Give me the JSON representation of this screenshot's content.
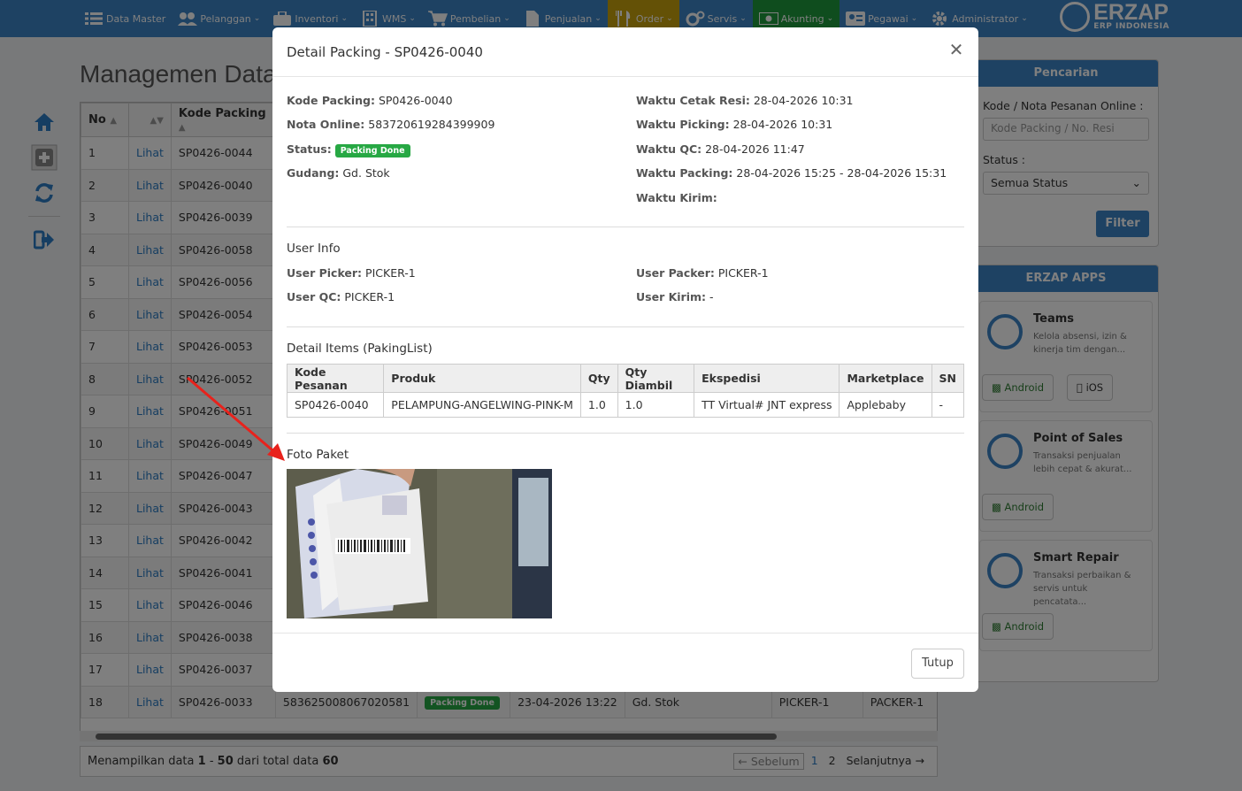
{
  "nav": {
    "items": [
      {
        "label": "Data Master",
        "icon": "list-icon"
      },
      {
        "label": "Pelanggan",
        "icon": "users-icon"
      },
      {
        "label": "Inventori",
        "icon": "briefcase-icon"
      },
      {
        "label": "WMS",
        "icon": "building-icon"
      },
      {
        "label": "Pembelian",
        "icon": "cart-icon"
      },
      {
        "label": "Penjualan",
        "icon": "document-icon"
      },
      {
        "label": "Order",
        "icon": "utensils-icon"
      },
      {
        "label": "Servis",
        "icon": "gears-icon"
      },
      {
        "label": "Akunting",
        "icon": "money-icon"
      },
      {
        "label": "Pegawai",
        "icon": "id-card-icon"
      },
      {
        "label": "Administrator",
        "icon": "gear-icon"
      }
    ],
    "brand": {
      "name": "ERZAP",
      "sub": "ERP INDONESIA"
    },
    "colors": {
      "bar": "#3c84c6",
      "order": "#c9a20d",
      "akunting": "#1f9a3c"
    }
  },
  "page": {
    "title": "Managemen Data"
  },
  "table": {
    "headers": [
      "No",
      "",
      "Kode Packing"
    ],
    "rows": [
      {
        "no": "1",
        "link": "Lihat",
        "kode": "SP0426-0044"
      },
      {
        "no": "2",
        "link": "Lihat",
        "kode": "SP0426-0040"
      },
      {
        "no": "3",
        "link": "Lihat",
        "kode": "SP0426-0039"
      },
      {
        "no": "4",
        "link": "Lihat",
        "kode": "SP0426-0058"
      },
      {
        "no": "5",
        "link": "Lihat",
        "kode": "SP0426-0056"
      },
      {
        "no": "6",
        "link": "Lihat",
        "kode": "SP0426-0054"
      },
      {
        "no": "7",
        "link": "Lihat",
        "kode": "SP0426-0053"
      },
      {
        "no": "8",
        "link": "Lihat",
        "kode": "SP0426-0052"
      },
      {
        "no": "9",
        "link": "Lihat",
        "kode": "SP0426-0051"
      },
      {
        "no": "10",
        "link": "Lihat",
        "kode": "SP0426-0049"
      },
      {
        "no": "11",
        "link": "Lihat",
        "kode": "SP0426-0047"
      },
      {
        "no": "12",
        "link": "Lihat",
        "kode": "SP0426-0043"
      },
      {
        "no": "13",
        "link": "Lihat",
        "kode": "SP0426-0042"
      },
      {
        "no": "14",
        "link": "Lihat",
        "kode": "SP0426-0041"
      },
      {
        "no": "15",
        "link": "Lihat",
        "kode": "SP0426-0046"
      },
      {
        "no": "16",
        "link": "Lihat",
        "kode": "SP0426-0038"
      },
      {
        "no": "17",
        "link": "Lihat",
        "kode": "SP0426-0037"
      },
      {
        "no": "18",
        "link": "Lihat",
        "kode": "SP0426-0033"
      }
    ],
    "row18_extra": {
      "nota": "583625008067020581",
      "status": "Packing Done",
      "waktu": "23-04-2026 13:22",
      "gudang": "Gd. Stok",
      "picker": "PICKER-1",
      "packer": "PACKER-1"
    }
  },
  "footer": {
    "info_prefix": "Menampilkan data",
    "range_start": "1",
    "range_sep": "-",
    "range_end": "50",
    "info_mid": "dari total data",
    "total": "60",
    "prev": "← Sebelum",
    "page1": "1",
    "page2": "2",
    "next": "Selanjutnya →"
  },
  "search": {
    "title": "Pencarian",
    "label1": "Kode / Nota Pesanan Online :",
    "placeholder": "Kode Packing / No. Resi",
    "label2": "Status :",
    "status_value": "Semua Status",
    "filter": "Filter"
  },
  "apps": {
    "title": "ERZAP APPS",
    "list": [
      {
        "name": "Teams",
        "desc": "Kelola absensi, izin & kinerja tim dengan...",
        "btn1": "Android",
        "btn2": "iOS"
      },
      {
        "name": "Point of Sales",
        "desc": "Transaksi penjualan lebih cepat & akurat...",
        "btn1": "Android"
      },
      {
        "name": "Smart Repair",
        "desc": "Transaksi perbaikan & servis untuk pencatata...",
        "btn1": "Android"
      }
    ]
  },
  "modal": {
    "title": "Detail Packing - SP0426-0040",
    "left": [
      {
        "k": "Kode Packing:",
        "v": "SP0426-0040"
      },
      {
        "k": "Nota Online:",
        "v": "583720619284399909"
      },
      {
        "k": "Status:",
        "badge": "Packing Done"
      },
      {
        "k": "Gudang:",
        "v": "Gd. Stok"
      }
    ],
    "right": [
      {
        "k": "Waktu Cetak Resi:",
        "v": "28-04-2026 10:31"
      },
      {
        "k": "Waktu Picking:",
        "v": "28-04-2026 10:31"
      },
      {
        "k": "Waktu QC:",
        "v": "28-04-2026 11:47"
      },
      {
        "k": "Waktu Packing:",
        "v": "28-04-2026 15:25 - 28-04-2026 15:31"
      },
      {
        "k": "Waktu Kirim:",
        "v": ""
      }
    ],
    "user_info_title": "User Info",
    "users_left": [
      {
        "k": "User Picker:",
        "v": "PICKER-1"
      },
      {
        "k": "User QC:",
        "v": "PICKER-1"
      }
    ],
    "users_right": [
      {
        "k": "User Packer:",
        "v": "PICKER-1"
      },
      {
        "k": "User Kirim:",
        "v": "-"
      }
    ],
    "items_title": "Detail Items (PakingList)",
    "items_headers": [
      "Kode Pesanan",
      "Produk",
      "Qty",
      "Qty Diambil",
      "Ekspedisi",
      "Marketplace",
      "SN"
    ],
    "items_rows": [
      [
        "SP0426-0040",
        "PELAMPUNG-ANGELWING-PINK-M",
        "1.0",
        "1.0",
        "TT Virtual# JNT express",
        "Applebaby",
        "-"
      ]
    ],
    "photo_title": "Foto Paket",
    "close_button": "Tutup",
    "badge_color": "#27a844"
  }
}
